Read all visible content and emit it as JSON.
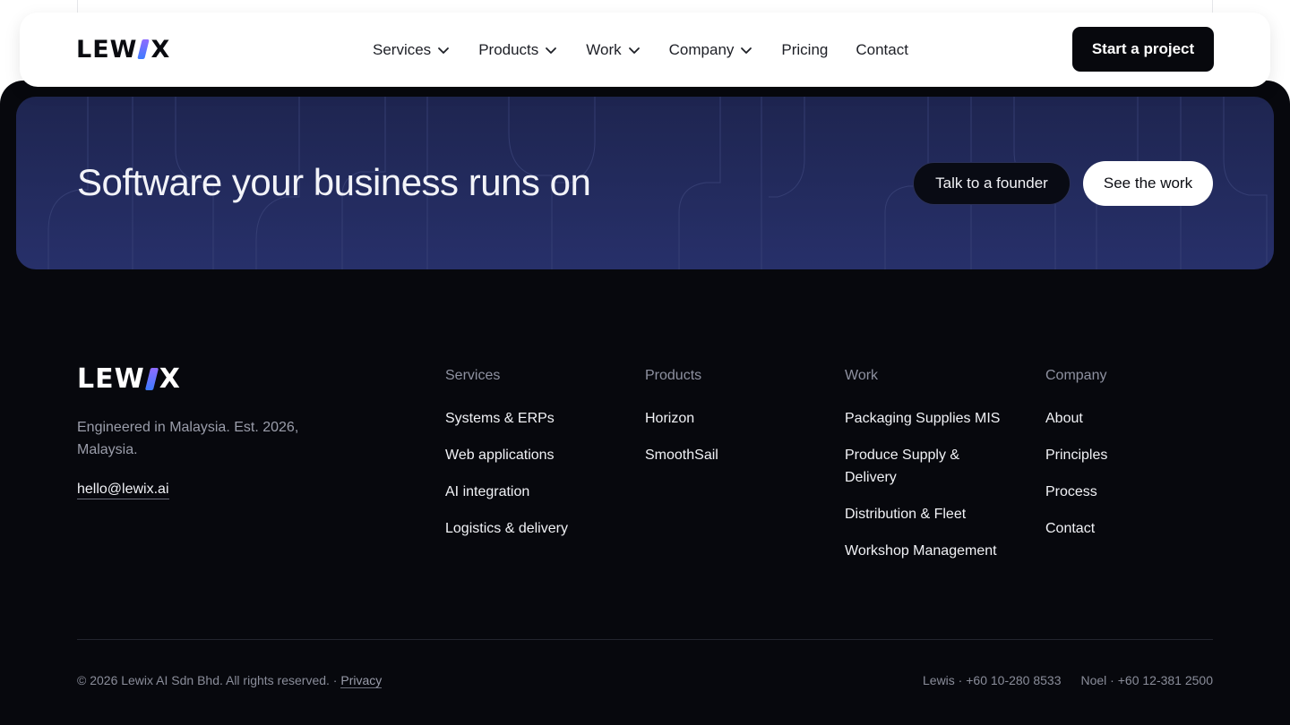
{
  "header": {
    "logo": {
      "left": "LEW",
      "right": "X"
    },
    "nav": [
      {
        "label": "Services",
        "dropdown": true
      },
      {
        "label": "Products",
        "dropdown": true
      },
      {
        "label": "Work",
        "dropdown": true
      },
      {
        "label": "Company",
        "dropdown": true
      },
      {
        "label": "Pricing",
        "dropdown": false
      },
      {
        "label": "Contact",
        "dropdown": false
      }
    ],
    "cta_label": "Start a project"
  },
  "banner": {
    "title": "Software your business runs on",
    "secondary_button": "Talk to a founder",
    "primary_button": "See the work"
  },
  "footer": {
    "logo": {
      "left": "LEW",
      "right": "X"
    },
    "tagline": "Engineered in Malaysia. Est. 2026, Malaysia.",
    "email": "hello@lewix.ai",
    "columns": [
      {
        "heading": "Services",
        "links": [
          "Systems & ERPs",
          "Web applications",
          "AI integration",
          "Logistics & delivery"
        ]
      },
      {
        "heading": "Products",
        "links": [
          "Horizon",
          "SmoothSail"
        ]
      },
      {
        "heading": "Work",
        "links": [
          "Packaging Supplies MIS",
          "Produce Supply & Delivery",
          "Distribution & Fleet",
          "Workshop Management"
        ]
      },
      {
        "heading": "Company",
        "links": [
          "About",
          "Principles",
          "Process",
          "Contact"
        ]
      }
    ],
    "copyright": "© 2026 Lewix AI Sdn Bhd. All rights reserved. ·",
    "privacy": "Privacy",
    "contacts": [
      "Lewis · +60 10-280 8533",
      "Noel · +60 12-381 2500"
    ]
  },
  "colors": {
    "dark_bg": "#07080d",
    "banner": "#232b5e",
    "logo_accent_top": "#8f6cff",
    "logo_accent_bottom": "#3d7bff"
  }
}
